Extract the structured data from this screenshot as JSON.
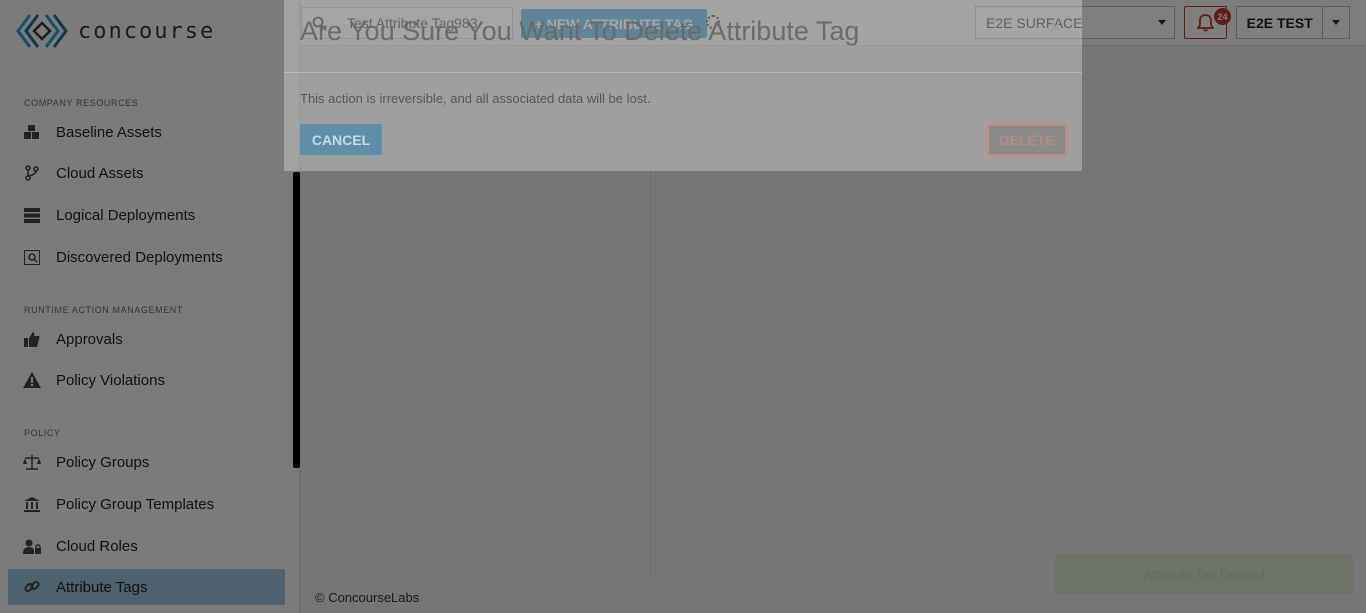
{
  "brand": {
    "name": "concourse"
  },
  "sidebar": {
    "sections": [
      {
        "title": "COMPANY RESOURCES",
        "items": [
          {
            "label": "Baseline Assets",
            "icon": "cubes-icon"
          },
          {
            "label": "Cloud Assets",
            "icon": "code-branch-icon"
          },
          {
            "label": "Logical Deployments",
            "icon": "server-icon"
          },
          {
            "label": "Discovered Deployments",
            "icon": "search-server-icon"
          }
        ]
      },
      {
        "title": "RUNTIME ACTION MANAGEMENT",
        "items": [
          {
            "label": "Approvals",
            "icon": "thumbs-up-icon"
          },
          {
            "label": "Policy Violations",
            "icon": "warning-icon"
          }
        ]
      },
      {
        "title": "POLICY",
        "items": [
          {
            "label": "Policy Groups",
            "icon": "balance-scale-icon"
          },
          {
            "label": "Policy Group Templates",
            "icon": "institution-icon"
          },
          {
            "label": "Cloud Roles",
            "icon": "user-lock-icon"
          },
          {
            "label": "Attribute Tags",
            "icon": "link-icon",
            "active": true
          }
        ]
      }
    ]
  },
  "topbar": {
    "search_value": "Test Attribute Tag983",
    "new_button_label": "+ NEW ATTRIBUTE TAG",
    "org_select_value": "E2E SURFACE",
    "notification_count": "24",
    "user_name": "E2E TEST"
  },
  "footer": {
    "text": "© ConcourseLabs"
  },
  "toast": {
    "text": "Attribute Tag Deleted"
  },
  "modal": {
    "title": "Are You Sure You Want To Delete Attribute Tag",
    "close_glyph": "×",
    "body": "This action is irreversible, and all associated data will be lost.",
    "cancel_label": "CANCEL",
    "delete_label": "DELETE"
  },
  "colors": {
    "accent": "#39a3dc",
    "active_nav": "#9dc3de",
    "alert": "#c0392b",
    "toast_bg": "#dfe8d2"
  }
}
